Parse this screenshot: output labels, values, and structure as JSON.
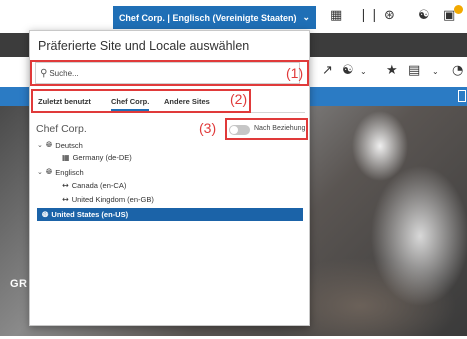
{
  "header": {
    "site_selector_label": "Chef Corp. | Englisch (Vereinigte Staaten)"
  },
  "hero": {
    "text": "GR"
  },
  "panel": {
    "title": "Präferierte Site und Locale auswählen",
    "search_placeholder": "Suche...",
    "tabs": [
      {
        "label": "Zuletzt benutzt",
        "active": false
      },
      {
        "label": "Chef Corp.",
        "active": true
      },
      {
        "label": "Andere Sites",
        "active": false
      }
    ],
    "tree_root": "Chef Corp.",
    "toggle_label": "Nach Beziehung",
    "tree": [
      {
        "label": "Deutsch",
        "icon": "globe-icon",
        "expand": "chevron-down-icon"
      },
      {
        "label": "Germany (de-DE)",
        "icon": "sitemap-icon"
      },
      {
        "label": "Englisch",
        "icon": "globe-icon",
        "expand": "chevron-down-icon"
      },
      {
        "label": "Canada (en-CA)",
        "icon": "arrows-horizontal-icon"
      },
      {
        "label": "United Kingdom (en-GB)",
        "icon": "arrows-horizontal-icon"
      },
      {
        "label": "United States (en-US)",
        "icon": "globe-icon",
        "selected": true
      }
    ]
  },
  "annotations": [
    {
      "number": "(1)"
    },
    {
      "number": "(2)"
    },
    {
      "number": "(3)"
    }
  ],
  "colors": {
    "accent": "#1f6fb6",
    "selected_row": "#1b63a8",
    "annotation_red": "#e03a3a",
    "dark_bar": "#3c3c3c"
  }
}
